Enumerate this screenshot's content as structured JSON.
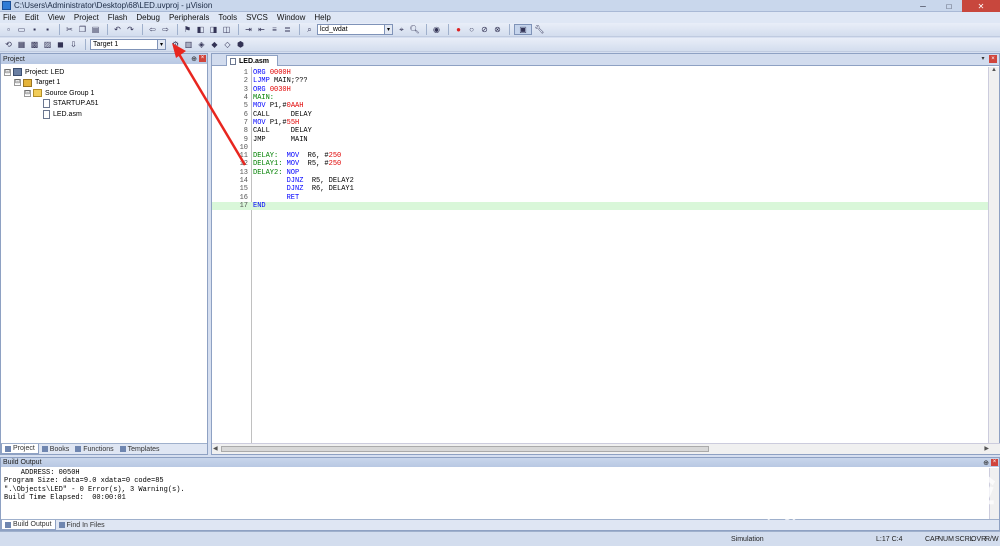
{
  "window": {
    "title": "C:\\Users\\Administrator\\Desktop\\68\\LED.uvproj - µVision",
    "controls": [
      "─",
      "□",
      "✕"
    ]
  },
  "menu": [
    "File",
    "Edit",
    "View",
    "Project",
    "Flash",
    "Debug",
    "Peripherals",
    "Tools",
    "SVCS",
    "Window",
    "Help"
  ],
  "toolbar": {
    "find_combo_value": "lcd_wdat",
    "target_combo_value": "Target 1"
  },
  "project_panel": {
    "header": "Project",
    "tree": [
      {
        "level": 0,
        "expander": "⊟",
        "icon": "proj",
        "label": "Project: LED"
      },
      {
        "level": 1,
        "expander": "⊟",
        "icon": "target",
        "label": "Target 1"
      },
      {
        "level": 2,
        "expander": "⊟",
        "icon": "folder",
        "label": "Source Group 1"
      },
      {
        "level": 3,
        "expander": "",
        "icon": "file",
        "label": "STARTUP.A51"
      },
      {
        "level": 3,
        "expander": "",
        "icon": "file",
        "label": "LED.asm"
      }
    ],
    "tabs": [
      "Project",
      "Books",
      "Functions",
      "Templates"
    ]
  },
  "editor": {
    "tab_label": "LED.asm",
    "current_line": 17,
    "lines": [
      [
        {
          "t": "ORG ",
          "c": "#0000ff"
        },
        {
          "t": "0000H",
          "c": "#e00000"
        }
      ],
      [
        {
          "t": "LJMP ",
          "c": "#0000ff"
        },
        {
          "t": "MAIN;???",
          "c": "#000000"
        }
      ],
      [
        {
          "t": "ORG ",
          "c": "#0000ff"
        },
        {
          "t": "0030H",
          "c": "#e00000"
        }
      ],
      [
        {
          "t": "MAIN:",
          "c": "#008000"
        }
      ],
      [
        {
          "t": "MOV ",
          "c": "#0000ff"
        },
        {
          "t": "P1,#",
          "c": "#000000"
        },
        {
          "t": "0AAH",
          "c": "#e00000"
        }
      ],
      [
        {
          "t": "CALL     DELAY",
          "c": "#000000"
        }
      ],
      [
        {
          "t": "MOV ",
          "c": "#0000ff"
        },
        {
          "t": "P1,#",
          "c": "#000000"
        },
        {
          "t": "55H",
          "c": "#e00000"
        }
      ],
      [
        {
          "t": "CALL     DELAY",
          "c": "#000000"
        }
      ],
      [
        {
          "t": "JMP      MAIN",
          "c": "#000000"
        }
      ],
      [
        {
          "t": "",
          "c": "#000000"
        }
      ],
      [
        {
          "t": "DELAY:  ",
          "c": "#008000"
        },
        {
          "t": "MOV  ",
          "c": "#0000ff"
        },
        {
          "t": "R6, #",
          "c": "#000000"
        },
        {
          "t": "250",
          "c": "#e00000"
        }
      ],
      [
        {
          "t": "DELAY1: ",
          "c": "#008000"
        },
        {
          "t": "MOV  ",
          "c": "#0000ff"
        },
        {
          "t": "R5, #",
          "c": "#000000"
        },
        {
          "t": "250",
          "c": "#e00000"
        }
      ],
      [
        {
          "t": "DELAY2: ",
          "c": "#008000"
        },
        {
          "t": "NOP",
          "c": "#0000ff"
        }
      ],
      [
        {
          "t": "        ",
          "c": "#000000"
        },
        {
          "t": "DJNZ  ",
          "c": "#0000ff"
        },
        {
          "t": "R5, DELAY2",
          "c": "#000000"
        }
      ],
      [
        {
          "t": "        ",
          "c": "#000000"
        },
        {
          "t": "DJNZ  ",
          "c": "#0000ff"
        },
        {
          "t": "R6, DELAY1",
          "c": "#000000"
        }
      ],
      [
        {
          "t": "        ",
          "c": "#000000"
        },
        {
          "t": "RET",
          "c": "#0000ff"
        }
      ],
      [
        {
          "t": "END",
          "c": "#0000ff"
        }
      ]
    ]
  },
  "build_output": {
    "header": "Build Output",
    "text": "    ADDRESS: 0050H\nProgram Size: data=9.0 xdata=0 code=85\n\".\\Objects\\LED\" - 0 Error(s), 3 Warning(s).\nBuild Time Elapsed:  00:00:01",
    "tabs": [
      "Build Output",
      "Find In Files"
    ]
  },
  "status": {
    "mode": "Simulation",
    "position": "L:17 C:4",
    "indicators": [
      "CAP",
      "NUM",
      "SCRL",
      "OVR",
      "R/W"
    ]
  },
  "watermark": {
    "logo": "Baidu 经验",
    "url": "jingyan.baidu.com"
  },
  "annotation_color": "#e8261f"
}
